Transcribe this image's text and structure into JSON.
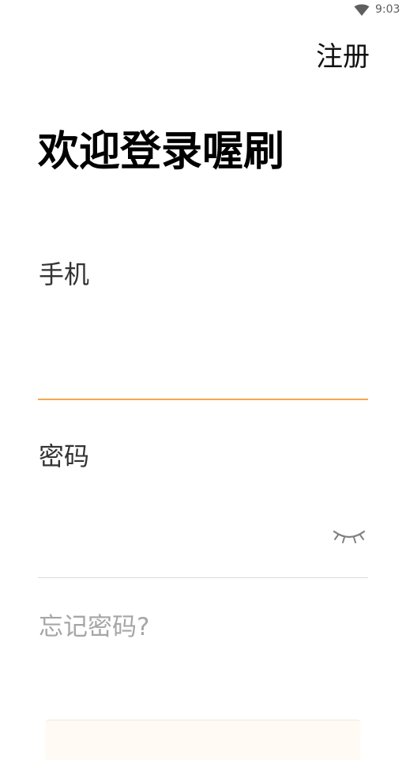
{
  "status_bar": {
    "time": "9:03",
    "icons": [
      "wifi-icon"
    ]
  },
  "header": {
    "register_label": "注册"
  },
  "main": {
    "title": "欢迎登录喔刷",
    "phone_field": {
      "label": "手机",
      "value": "",
      "placeholder": ""
    },
    "password_field": {
      "label": "密码",
      "value": "",
      "placeholder": "",
      "toggle_icon": "eye-closed-icon"
    },
    "forgot_password_label": "忘记密码?"
  },
  "colors": {
    "accent": "#f8a64f",
    "divider": "#d9d9d9",
    "muted_text": "#a6a6a6"
  }
}
